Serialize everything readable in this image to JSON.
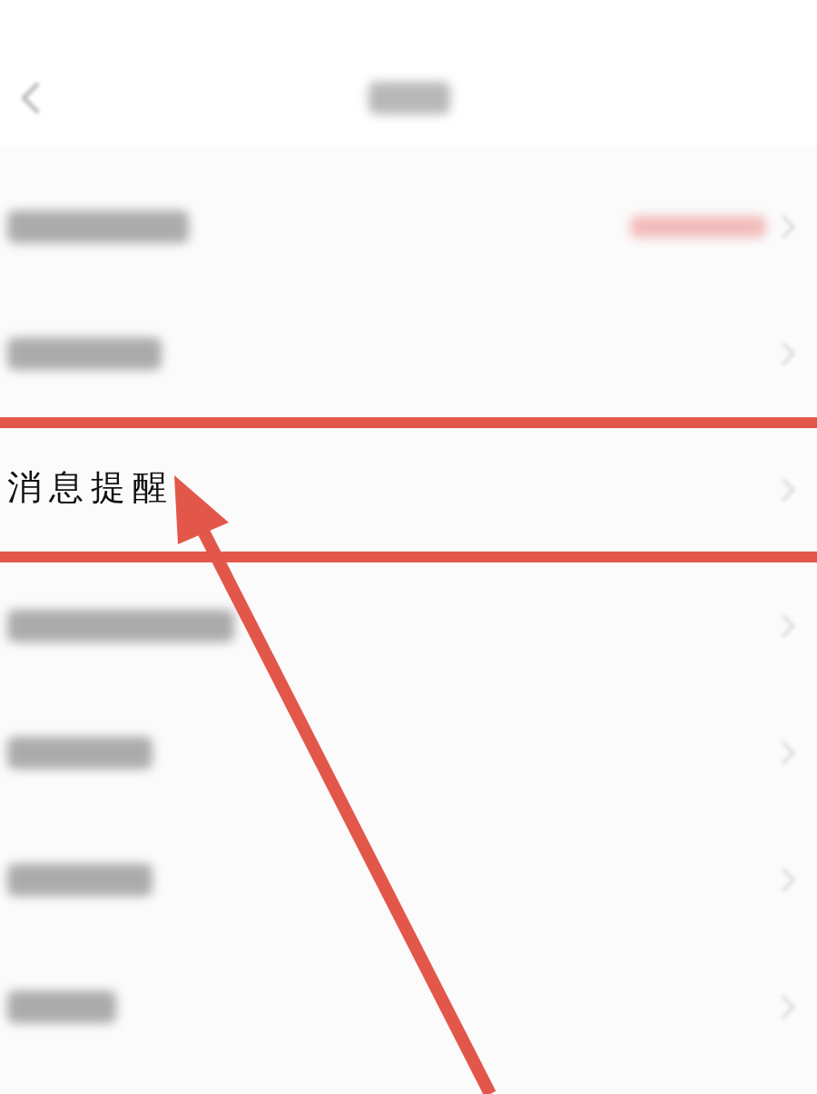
{
  "header": {
    "kind": "blurred"
  },
  "rows": [
    {
      "kind": "blurred",
      "has_value": true,
      "highlighted": false
    },
    {
      "kind": "blurred",
      "has_value": false,
      "highlighted": false
    },
    {
      "kind": "text",
      "label": "消息提醒",
      "has_value": false,
      "highlighted": true
    },
    {
      "kind": "blurred",
      "has_value": false,
      "highlighted": false
    },
    {
      "kind": "blurred",
      "has_value": false,
      "highlighted": false
    },
    {
      "kind": "blurred",
      "has_value": false,
      "highlighted": false
    },
    {
      "kind": "blurred",
      "has_value": false,
      "highlighted": false
    }
  ],
  "annotation": {
    "kind": "arrow"
  }
}
